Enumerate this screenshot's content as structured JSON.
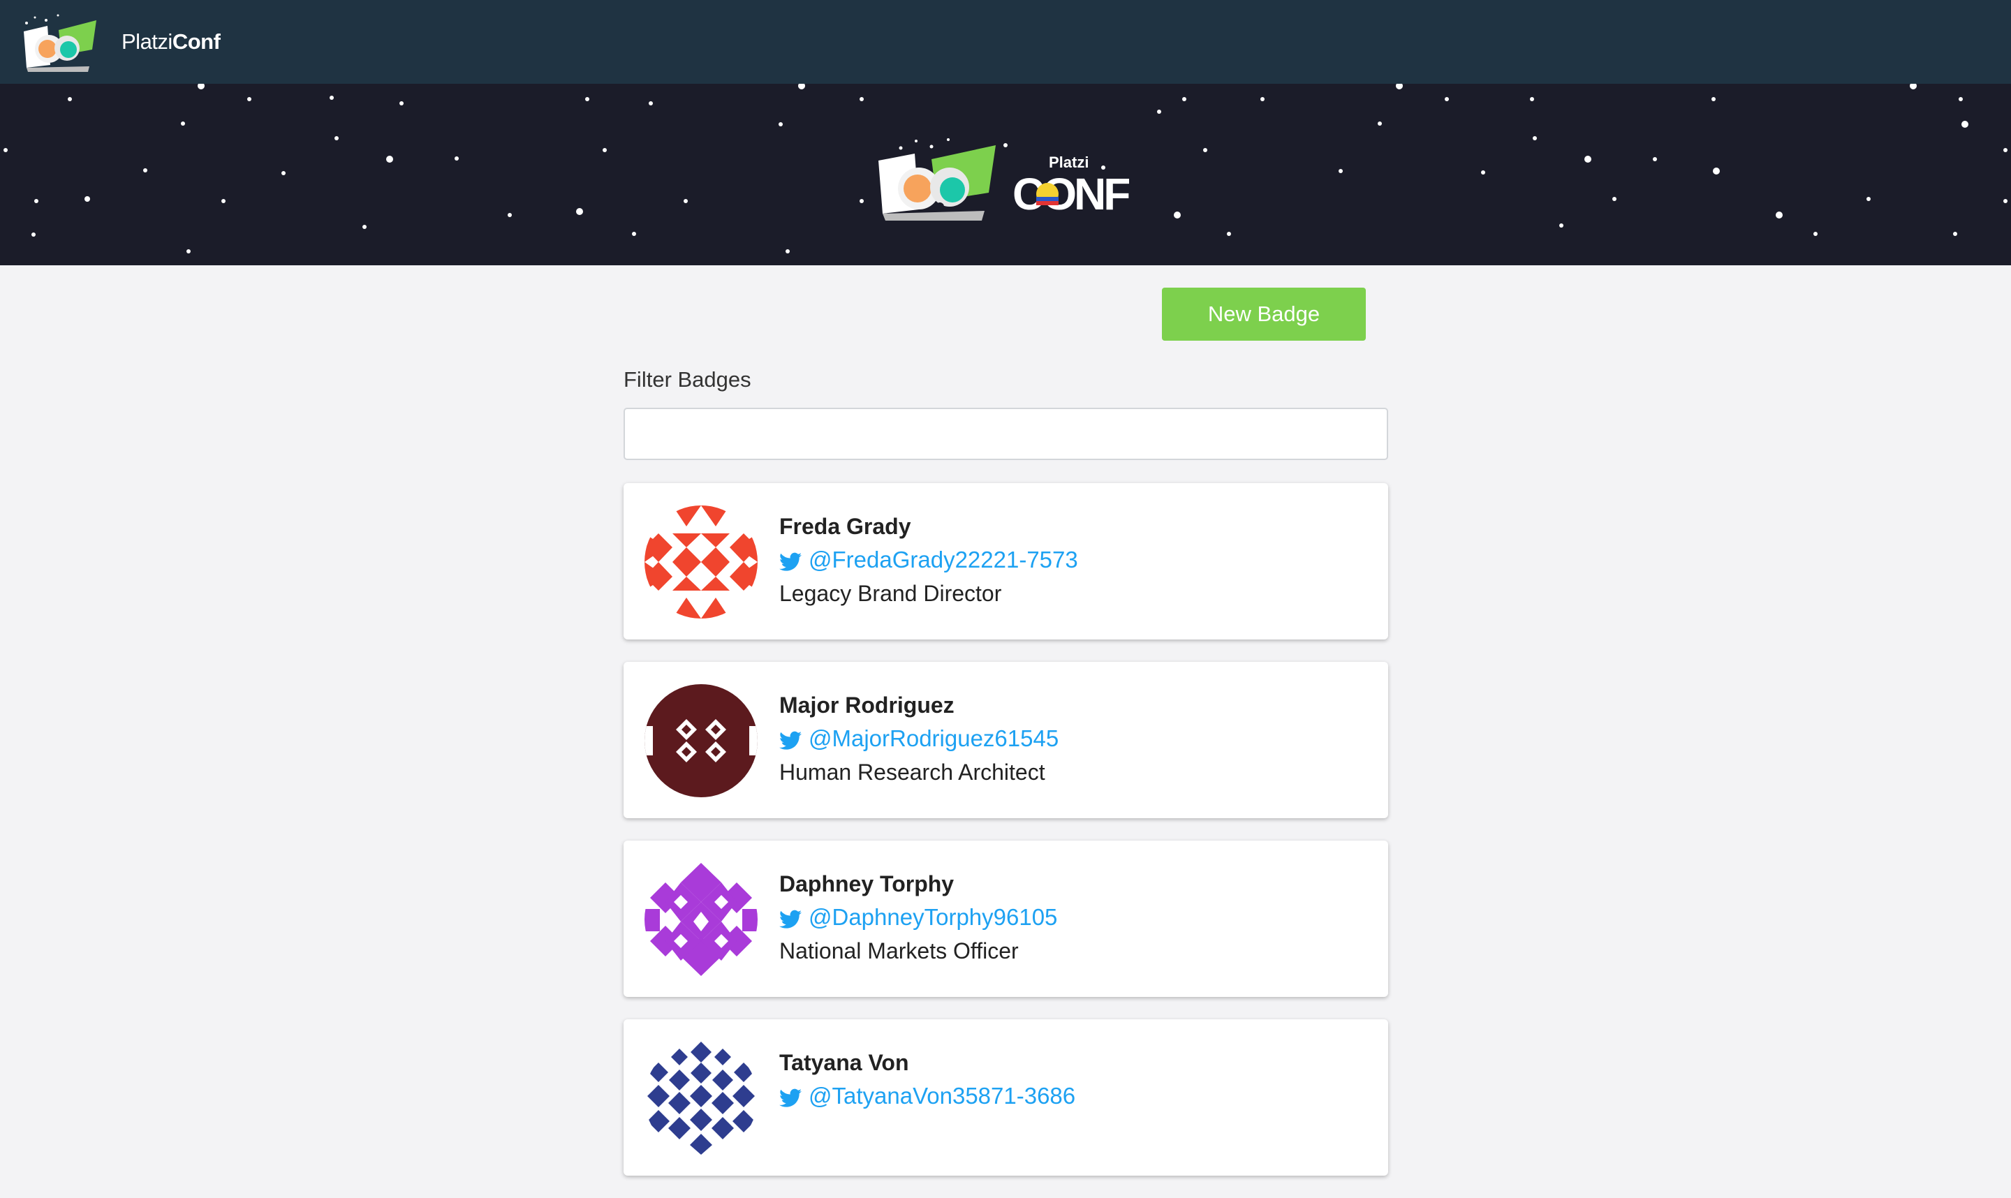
{
  "navbar": {
    "brand_light": "Platzi",
    "brand_bold": "Conf"
  },
  "hero": {
    "logo_small_text": "Platzi",
    "logo_big_text": "CONF"
  },
  "actions": {
    "new_badge_label": "New Badge"
  },
  "filter": {
    "label": "Filter Badges",
    "value": ""
  },
  "badges": [
    {
      "name": "Freda Grady",
      "twitter": "@FredaGrady22221-7573",
      "job_title": "Legacy Brand Director",
      "avatar_color": "#f0452e"
    },
    {
      "name": "Major Rodriguez",
      "twitter": "@MajorRodriguez61545",
      "job_title": "Human Research Architect",
      "avatar_color": "#5c1a1e"
    },
    {
      "name": "Daphney Torphy",
      "twitter": "@DaphneyTorphy96105",
      "job_title": "National Markets Officer",
      "avatar_color": "#a93bd9"
    },
    {
      "name": "Tatyana Von",
      "twitter": "@TatyanaVon35871-3686",
      "job_title": "",
      "avatar_color": "#2e3d8f"
    }
  ],
  "colors": {
    "navbar_bg": "#1f3342",
    "hero_bg": "#1b1c29",
    "accent_green": "#7dd04d",
    "twitter_blue": "#1da1f2"
  }
}
